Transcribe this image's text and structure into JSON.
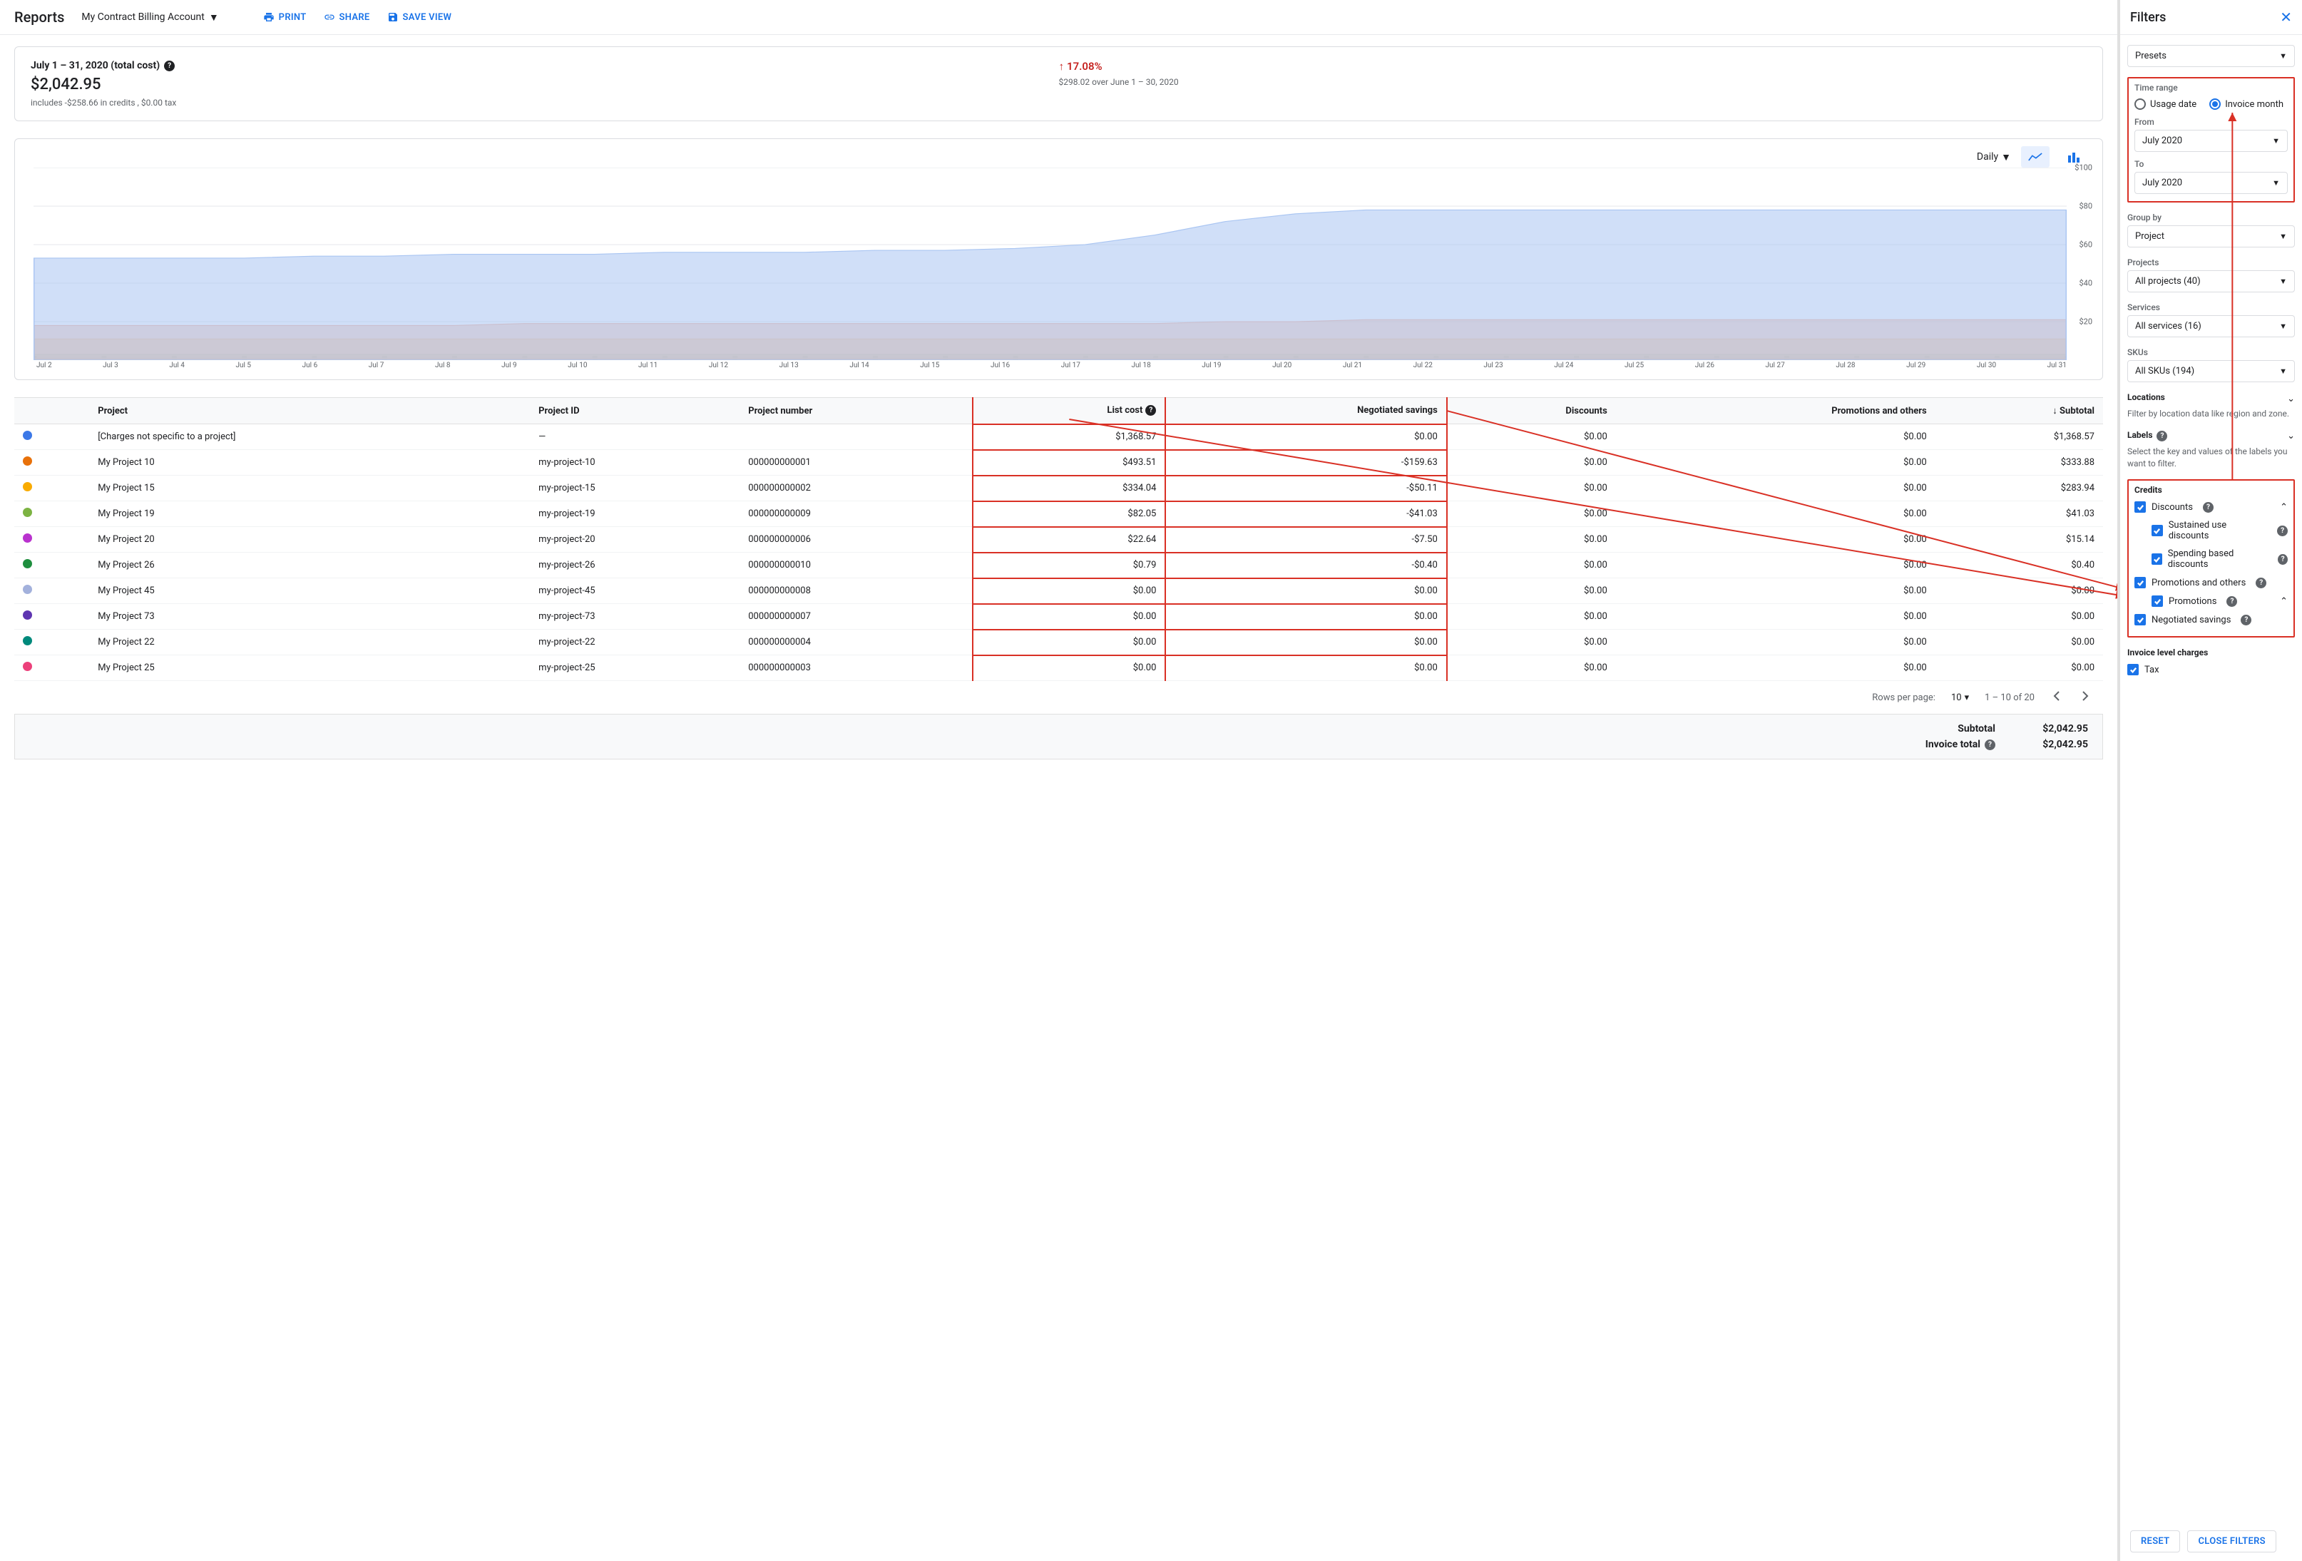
{
  "header": {
    "title": "Reports",
    "account": "My Contract Billing Account",
    "print": "PRINT",
    "share": "SHARE",
    "save": "SAVE VIEW"
  },
  "summary": {
    "range_label": "July 1 – 31, 2020 (total cost)",
    "total": "$2,042.95",
    "sub": "includes -$258.66 in credits , $0.00 tax",
    "delta_pct": "17.08%",
    "delta_sub": "$298.02 over June 1 – 30, 2020"
  },
  "chart_toolbar": {
    "daily": "Daily"
  },
  "chart_data": {
    "type": "area",
    "title": "",
    "ylabel": "",
    "xlabel": "",
    "ylim": [
      0,
      100
    ],
    "x": [
      "Jul 2",
      "Jul 3",
      "Jul 4",
      "Jul 5",
      "Jul 6",
      "Jul 7",
      "Jul 8",
      "Jul 9",
      "Jul 10",
      "Jul 11",
      "Jul 12",
      "Jul 13",
      "Jul 14",
      "Jul 15",
      "Jul 16",
      "Jul 17",
      "Jul 18",
      "Jul 19",
      "Jul 20",
      "Jul 21",
      "Jul 22",
      "Jul 23",
      "Jul 24",
      "Jul 25",
      "Jul 26",
      "Jul 27",
      "Jul 28",
      "Jul 29",
      "Jul 30",
      "Jul 31"
    ],
    "yticks": [
      20,
      40,
      60,
      80,
      100
    ],
    "series": [
      {
        "name": "[Charges not specific to a project]",
        "color": "#a9c5f2",
        "values": [
          53,
          53,
          53,
          53,
          54,
          54,
          55,
          55,
          55,
          56,
          56,
          56,
          57,
          57,
          58,
          60,
          65,
          72,
          76,
          78,
          78,
          78,
          78,
          78,
          78,
          78,
          78,
          78,
          78,
          78
        ]
      },
      {
        "name": "My Project 10",
        "color": "#f4b9a2",
        "values": [
          18,
          18,
          18,
          18,
          18,
          18,
          18,
          19,
          19,
          19,
          19,
          19,
          19,
          19,
          19,
          19,
          19,
          20,
          20,
          21,
          21,
          21,
          21,
          21,
          21,
          21,
          21,
          21,
          21,
          21
        ]
      },
      {
        "name": "My Project 15",
        "color": "#f6d693",
        "values": [
          11,
          11,
          11,
          11,
          11,
          11,
          11,
          11,
          11,
          11,
          11,
          11,
          11,
          11,
          11,
          11,
          11,
          11,
          11,
          11,
          11,
          11,
          11,
          11,
          11,
          11,
          11,
          11,
          11,
          11
        ]
      },
      {
        "name": "My Project 19",
        "color": "#a7e0b7",
        "values": [
          3,
          3,
          3,
          3,
          3,
          3,
          3,
          3,
          3,
          3,
          3,
          3,
          3,
          3,
          3,
          3,
          3,
          3,
          3,
          3,
          3,
          3,
          3,
          3,
          3,
          3,
          3,
          3,
          3,
          3
        ]
      },
      {
        "name": "My Project 20",
        "color": "#c9a8e8",
        "values": [
          1,
          1,
          1,
          1,
          1,
          1,
          1,
          1,
          1,
          1,
          1,
          1,
          1,
          1,
          1,
          1,
          1,
          1,
          1,
          1,
          1,
          1,
          1,
          1,
          1,
          1,
          1,
          1,
          1,
          1
        ]
      }
    ]
  },
  "table": {
    "headers": {
      "project": "Project",
      "project_id": "Project ID",
      "project_number": "Project number",
      "list_cost": "List cost",
      "negotiated": "Negotiated savings",
      "discounts": "Discounts",
      "promotions": "Promotions and others",
      "subtotal": "Subtotal"
    },
    "rows": [
      {
        "color": "#3b78e7",
        "project": "[Charges not specific to a project]",
        "id": "—",
        "num": "",
        "list": "$1,368.57",
        "neg": "$0.00",
        "disc": "$0.00",
        "promo": "$0.00",
        "sub": "$1,368.57"
      },
      {
        "color": "#e8710a",
        "project": "My Project 10",
        "id": "my-project-10",
        "num": "000000000001",
        "list": "$493.51",
        "neg": "-$159.63",
        "disc": "$0.00",
        "promo": "$0.00",
        "sub": "$333.88"
      },
      {
        "color": "#f9ab00",
        "project": "My Project 15",
        "id": "my-project-15",
        "num": "000000000002",
        "list": "$334.04",
        "neg": "-$50.11",
        "disc": "$0.00",
        "promo": "$0.00",
        "sub": "$283.94"
      },
      {
        "color": "#7cb342",
        "project": "My Project 19",
        "id": "my-project-19",
        "num": "000000000009",
        "list": "$82.05",
        "neg": "-$41.03",
        "disc": "$0.00",
        "promo": "$0.00",
        "sub": "$41.03"
      },
      {
        "color": "#b932ce",
        "project": "My Project 20",
        "id": "my-project-20",
        "num": "000000000006",
        "list": "$22.64",
        "neg": "-$7.50",
        "disc": "$0.00",
        "promo": "$0.00",
        "sub": "$15.14"
      },
      {
        "color": "#1e8e3e",
        "project": "My Project 26",
        "id": "my-project-26",
        "num": "000000000010",
        "list": "$0.79",
        "neg": "-$0.40",
        "disc": "$0.00",
        "promo": "$0.00",
        "sub": "$0.40"
      },
      {
        "color": "#a3b1dc",
        "project": "My Project 45",
        "id": "my-project-45",
        "num": "000000000008",
        "list": "$0.00",
        "neg": "$0.00",
        "disc": "$0.00",
        "promo": "$0.00",
        "sub": "$0.00"
      },
      {
        "color": "#5e35b1",
        "project": "My Project 73",
        "id": "my-project-73",
        "num": "000000000007",
        "list": "$0.00",
        "neg": "$0.00",
        "disc": "$0.00",
        "promo": "$0.00",
        "sub": "$0.00"
      },
      {
        "color": "#00897b",
        "project": "My Project 22",
        "id": "my-project-22",
        "num": "000000000004",
        "list": "$0.00",
        "neg": "$0.00",
        "disc": "$0.00",
        "promo": "$0.00",
        "sub": "$0.00"
      },
      {
        "color": "#ec407a",
        "project": "My Project 25",
        "id": "my-project-25",
        "num": "000000000003",
        "list": "$0.00",
        "neg": "$0.00",
        "disc": "$0.00",
        "promo": "$0.00",
        "sub": "$0.00"
      }
    ],
    "pagination": {
      "rows_per_page_label": "Rows per page:",
      "rows_per_page": "10",
      "range": "1 – 10 of 20"
    },
    "totals": {
      "subtotal_label": "Subtotal",
      "subtotal": "$2,042.95",
      "invoice_label": "Invoice total",
      "invoice": "$2,042.95"
    }
  },
  "filters": {
    "title": "Filters",
    "presets": "Presets",
    "time_range": {
      "label": "Time range",
      "usage": "Usage date",
      "invoice": "Invoice month",
      "from_label": "From",
      "from": "July 2020",
      "to_label": "To",
      "to": "July 2020"
    },
    "group_by": {
      "label": "Group by",
      "value": "Project"
    },
    "projects": {
      "label": "Projects",
      "value": "All projects (40)"
    },
    "services": {
      "label": "Services",
      "value": "All services (16)"
    },
    "skus": {
      "label": "SKUs",
      "value": "All SKUs (194)"
    },
    "locations": {
      "label": "Locations",
      "help": "Filter by location data like region and zone."
    },
    "labels": {
      "label": "Labels",
      "help": "Select the key and values of the labels you want to filter."
    },
    "credits": {
      "label": "Credits",
      "discounts": "Discounts",
      "sustained": "Sustained use discounts",
      "spending": "Spending based discounts",
      "promotions_others": "Promotions and others",
      "promotions": "Promotions",
      "negotiated": "Negotiated savings"
    },
    "invoice_charges": {
      "label": "Invoice level charges",
      "tax": "Tax"
    },
    "reset": "RESET",
    "close": "CLOSE FILTERS"
  }
}
